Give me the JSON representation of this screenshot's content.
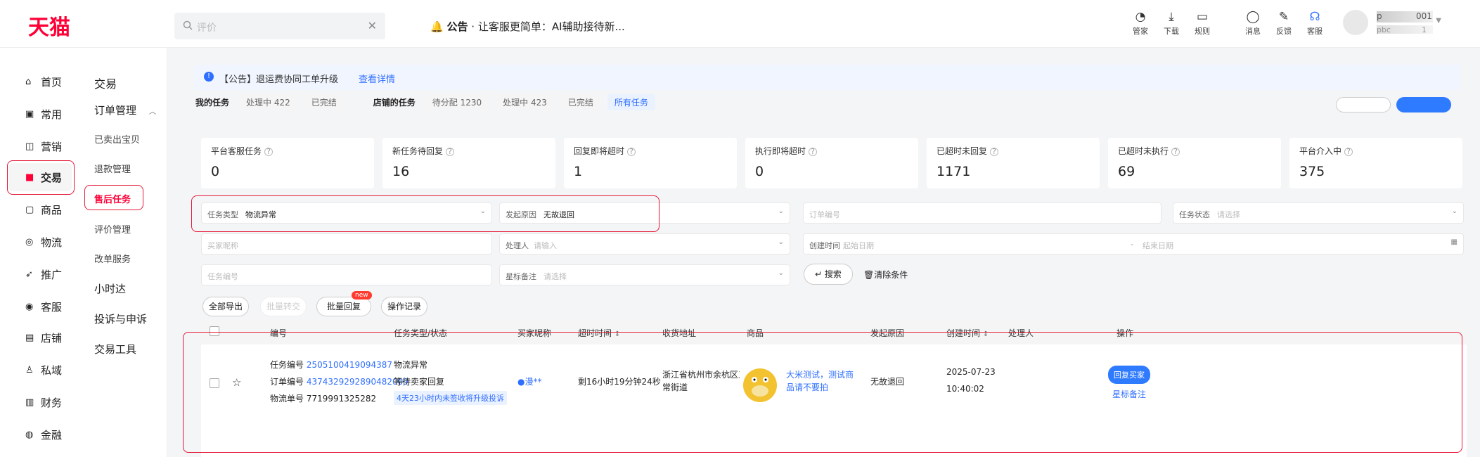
{
  "topbar": {
    "logo": "天猫",
    "search_placeholder": "评价",
    "notice_icon": "bell-icon",
    "notice_title": "公告",
    "notice_dot": "·",
    "notice_text": "让客服更简单：AI辅助接待新...",
    "tools": [
      {
        "label": "管家",
        "icon": "butler-icon"
      },
      {
        "label": "下载",
        "icon": "download-icon"
      },
      {
        "label": "规则",
        "icon": "rules-icon"
      },
      {
        "label": "消息",
        "icon": "message-icon"
      },
      {
        "label": "反馈",
        "icon": "feedback-icon"
      },
      {
        "label": "客服",
        "icon": "headset-icon"
      }
    ],
    "profile_suffix_top": "001",
    "profile_prefix_top": "p",
    "profile_prefix_sub": "pbc",
    "profile_suffix_sub": "1"
  },
  "nav_primary": [
    {
      "label": "首页",
      "icon": "home-icon"
    },
    {
      "label": "常用",
      "icon": "briefcase-icon"
    },
    {
      "label": "营销",
      "icon": "marketing-icon"
    },
    {
      "label": "交易",
      "icon": "trade-icon",
      "active": true
    },
    {
      "label": "商品",
      "icon": "product-icon"
    },
    {
      "label": "物流",
      "icon": "logistics-icon"
    },
    {
      "label": "推广",
      "icon": "promote-icon"
    },
    {
      "label": "客服",
      "icon": "service-icon"
    },
    {
      "label": "店铺",
      "icon": "shop-icon"
    },
    {
      "label": "私域",
      "icon": "private-icon"
    },
    {
      "label": "财务",
      "icon": "finance-icon"
    },
    {
      "label": "金融",
      "icon": "money-icon"
    }
  ],
  "nav_secondary": {
    "title": "交易",
    "group": "订单管理",
    "items": [
      "已卖出宝贝",
      "退款管理",
      "售后任务",
      "评价管理",
      "改单服务"
    ],
    "active": "售后任务",
    "others": [
      "小时达",
      "投诉与申诉",
      "交易工具"
    ]
  },
  "notice_bar": {
    "text": "【公告】退运费协同工单升级",
    "link": "查看详情"
  },
  "task_tabs": {
    "my_label": "我的任务",
    "my_items": [
      "处理中 422",
      "已完结"
    ],
    "shop_label": "店铺的任务",
    "shop_items": [
      "待分配 1230",
      "处理中 423",
      "已完结",
      "所有任务"
    ],
    "active": "所有任务"
  },
  "stats": [
    {
      "label": "平台客服任务",
      "value": "0"
    },
    {
      "label": "新任务待回复",
      "value": "16"
    },
    {
      "label": "回复即将超时",
      "value": "1"
    },
    {
      "label": "执行即将超时",
      "value": "0"
    },
    {
      "label": "已超时未回复",
      "value": "1171"
    },
    {
      "label": "已超时未执行",
      "value": "69"
    },
    {
      "label": "平台介入中",
      "value": "375"
    }
  ],
  "filters": {
    "task_type_label": "任务类型",
    "task_type_value": "物流异常",
    "reason_label": "发起原因",
    "reason_value": "无故退回",
    "order_no_placeholder": "订单编号",
    "task_status_label": "任务状态",
    "task_status_placeholder": "请选择",
    "buyer_placeholder": "买家昵称",
    "handler_label": "处理人",
    "handler_placeholder": "请输入",
    "created_label": "创建时间",
    "start_placeholder": "起始日期",
    "end_placeholder": "结束日期",
    "date_sep": "-",
    "task_no_placeholder": "任务编号",
    "star_label": "星标备注",
    "star_placeholder": "请选择",
    "search_label": "搜索",
    "clear_label": "清除条件"
  },
  "actions": {
    "export_all": "全部导出",
    "batch_transfer": "批量转交",
    "batch_reply": "批量回复",
    "new_badge": "new",
    "op_log": "操作记录"
  },
  "table": {
    "headers": [
      "编号",
      "任务类型/状态",
      "买家昵称",
      "超时时间",
      "收货地址",
      "商品",
      "发起原因",
      "创建时间",
      "处理人",
      "操作"
    ],
    "sort_icon": "⇕",
    "row": {
      "task_no_label": "任务编号",
      "task_no": "2505100419094387",
      "order_no_label": "订单编号",
      "order_no": "4374329292890482009",
      "waybill_label": "物流单号",
      "waybill": "7719991325282",
      "type": "物流异常",
      "status": "等待卖家回复",
      "status_tag": "4天23小时内未签收将升级投诉",
      "buyer": "漫**",
      "timeout": "剩16小时19分钟24秒",
      "address": "浙江省杭州市余杭区五常街道",
      "product": "大米测试，测试商品请不要拍",
      "reason": "无故退回",
      "created_date": "2025-07-23",
      "created_time": "10:40:02",
      "handler": "",
      "action_reply": "回复买家",
      "action_star": "星标备注"
    }
  },
  "colors": {
    "brand": "#ff0036",
    "link": "#2f6fff",
    "highlight_box": "#e31937"
  }
}
